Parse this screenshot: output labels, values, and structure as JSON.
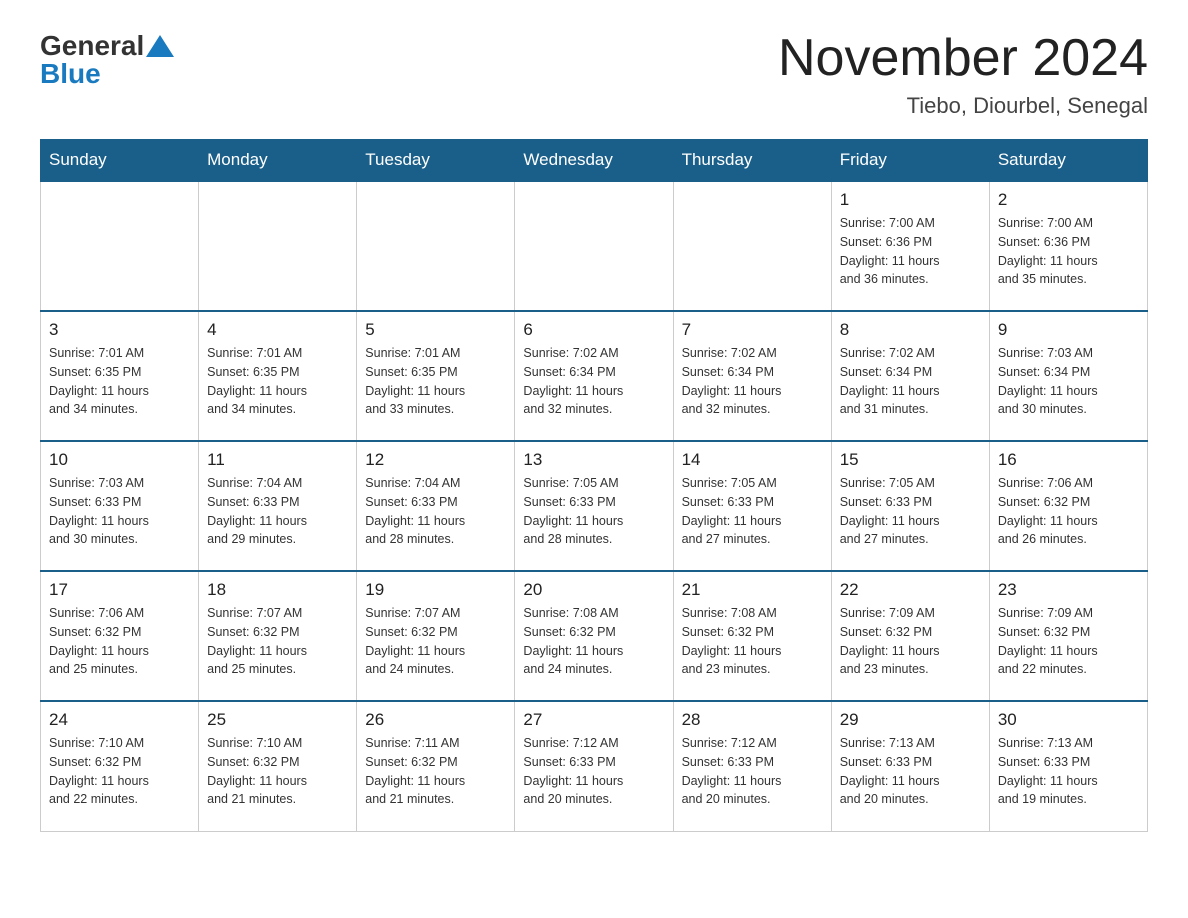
{
  "logo": {
    "general": "General",
    "blue": "Blue"
  },
  "title": "November 2024",
  "subtitle": "Tiebo, Diourbel, Senegal",
  "days_of_week": [
    "Sunday",
    "Monday",
    "Tuesday",
    "Wednesday",
    "Thursday",
    "Friday",
    "Saturday"
  ],
  "weeks": [
    [
      {
        "day": "",
        "info": ""
      },
      {
        "day": "",
        "info": ""
      },
      {
        "day": "",
        "info": ""
      },
      {
        "day": "",
        "info": ""
      },
      {
        "day": "",
        "info": ""
      },
      {
        "day": "1",
        "info": "Sunrise: 7:00 AM\nSunset: 6:36 PM\nDaylight: 11 hours\nand 36 minutes."
      },
      {
        "day": "2",
        "info": "Sunrise: 7:00 AM\nSunset: 6:36 PM\nDaylight: 11 hours\nand 35 minutes."
      }
    ],
    [
      {
        "day": "3",
        "info": "Sunrise: 7:01 AM\nSunset: 6:35 PM\nDaylight: 11 hours\nand 34 minutes."
      },
      {
        "day": "4",
        "info": "Sunrise: 7:01 AM\nSunset: 6:35 PM\nDaylight: 11 hours\nand 34 minutes."
      },
      {
        "day": "5",
        "info": "Sunrise: 7:01 AM\nSunset: 6:35 PM\nDaylight: 11 hours\nand 33 minutes."
      },
      {
        "day": "6",
        "info": "Sunrise: 7:02 AM\nSunset: 6:34 PM\nDaylight: 11 hours\nand 32 minutes."
      },
      {
        "day": "7",
        "info": "Sunrise: 7:02 AM\nSunset: 6:34 PM\nDaylight: 11 hours\nand 32 minutes."
      },
      {
        "day": "8",
        "info": "Sunrise: 7:02 AM\nSunset: 6:34 PM\nDaylight: 11 hours\nand 31 minutes."
      },
      {
        "day": "9",
        "info": "Sunrise: 7:03 AM\nSunset: 6:34 PM\nDaylight: 11 hours\nand 30 minutes."
      }
    ],
    [
      {
        "day": "10",
        "info": "Sunrise: 7:03 AM\nSunset: 6:33 PM\nDaylight: 11 hours\nand 30 minutes."
      },
      {
        "day": "11",
        "info": "Sunrise: 7:04 AM\nSunset: 6:33 PM\nDaylight: 11 hours\nand 29 minutes."
      },
      {
        "day": "12",
        "info": "Sunrise: 7:04 AM\nSunset: 6:33 PM\nDaylight: 11 hours\nand 28 minutes."
      },
      {
        "day": "13",
        "info": "Sunrise: 7:05 AM\nSunset: 6:33 PM\nDaylight: 11 hours\nand 28 minutes."
      },
      {
        "day": "14",
        "info": "Sunrise: 7:05 AM\nSunset: 6:33 PM\nDaylight: 11 hours\nand 27 minutes."
      },
      {
        "day": "15",
        "info": "Sunrise: 7:05 AM\nSunset: 6:33 PM\nDaylight: 11 hours\nand 27 minutes."
      },
      {
        "day": "16",
        "info": "Sunrise: 7:06 AM\nSunset: 6:32 PM\nDaylight: 11 hours\nand 26 minutes."
      }
    ],
    [
      {
        "day": "17",
        "info": "Sunrise: 7:06 AM\nSunset: 6:32 PM\nDaylight: 11 hours\nand 25 minutes."
      },
      {
        "day": "18",
        "info": "Sunrise: 7:07 AM\nSunset: 6:32 PM\nDaylight: 11 hours\nand 25 minutes."
      },
      {
        "day": "19",
        "info": "Sunrise: 7:07 AM\nSunset: 6:32 PM\nDaylight: 11 hours\nand 24 minutes."
      },
      {
        "day": "20",
        "info": "Sunrise: 7:08 AM\nSunset: 6:32 PM\nDaylight: 11 hours\nand 24 minutes."
      },
      {
        "day": "21",
        "info": "Sunrise: 7:08 AM\nSunset: 6:32 PM\nDaylight: 11 hours\nand 23 minutes."
      },
      {
        "day": "22",
        "info": "Sunrise: 7:09 AM\nSunset: 6:32 PM\nDaylight: 11 hours\nand 23 minutes."
      },
      {
        "day": "23",
        "info": "Sunrise: 7:09 AM\nSunset: 6:32 PM\nDaylight: 11 hours\nand 22 minutes."
      }
    ],
    [
      {
        "day": "24",
        "info": "Sunrise: 7:10 AM\nSunset: 6:32 PM\nDaylight: 11 hours\nand 22 minutes."
      },
      {
        "day": "25",
        "info": "Sunrise: 7:10 AM\nSunset: 6:32 PM\nDaylight: 11 hours\nand 21 minutes."
      },
      {
        "day": "26",
        "info": "Sunrise: 7:11 AM\nSunset: 6:32 PM\nDaylight: 11 hours\nand 21 minutes."
      },
      {
        "day": "27",
        "info": "Sunrise: 7:12 AM\nSunset: 6:33 PM\nDaylight: 11 hours\nand 20 minutes."
      },
      {
        "day": "28",
        "info": "Sunrise: 7:12 AM\nSunset: 6:33 PM\nDaylight: 11 hours\nand 20 minutes."
      },
      {
        "day": "29",
        "info": "Sunrise: 7:13 AM\nSunset: 6:33 PM\nDaylight: 11 hours\nand 20 minutes."
      },
      {
        "day": "30",
        "info": "Sunrise: 7:13 AM\nSunset: 6:33 PM\nDaylight: 11 hours\nand 19 minutes."
      }
    ]
  ]
}
